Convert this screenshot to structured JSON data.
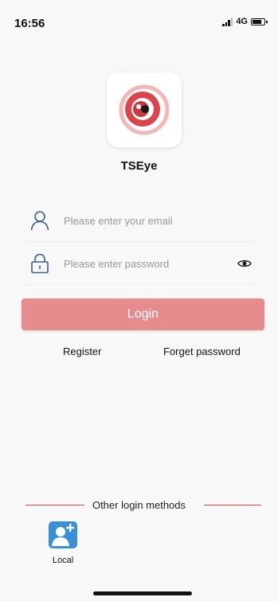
{
  "status_bar": {
    "time": "16:56",
    "network": "4G"
  },
  "app": {
    "name": "TSEye",
    "logo_icon": "eye-logo-icon",
    "brand_color": "#d9454a"
  },
  "form": {
    "email_placeholder": "Please enter your email",
    "password_placeholder": "Please enter password",
    "email_icon": "user-icon",
    "password_icon": "lock-icon",
    "show_password_icon": "eye-icon"
  },
  "actions": {
    "login_label": "Login",
    "register_label": "Register",
    "forget_password_label": "Forget password",
    "login_button_color": "#e68c8c"
  },
  "other_login": {
    "title": "Other login methods",
    "methods": [
      {
        "label": "Local",
        "icon": "add-user-icon",
        "color": "#3a8fd9"
      }
    ]
  }
}
